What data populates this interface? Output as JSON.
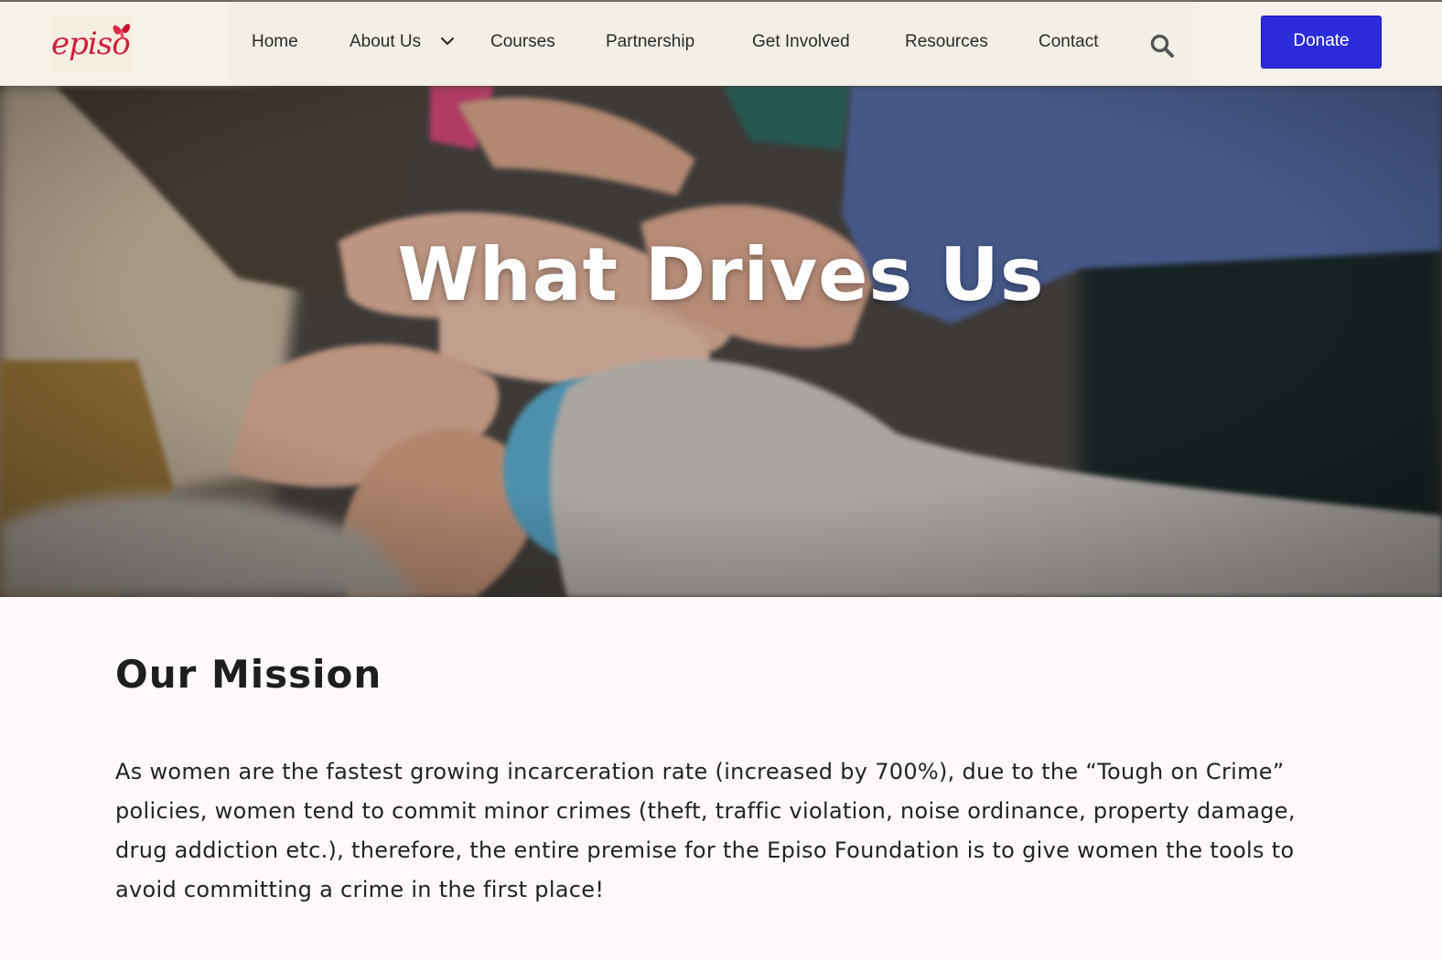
{
  "brand": {
    "logo_text": "episo",
    "accent_color": "#d11e3c"
  },
  "nav": {
    "items": [
      {
        "label": "Home"
      },
      {
        "label": "About Us",
        "has_dropdown": true
      },
      {
        "label": "Courses"
      },
      {
        "label": "Partnership"
      },
      {
        "label": "Get Involved"
      },
      {
        "label": "Resources"
      },
      {
        "label": "Contact"
      }
    ],
    "search_icon": "search-icon",
    "dropdown_icon": "chevron-down-icon"
  },
  "donate": {
    "label": "Donate",
    "color": "#2c2bd9"
  },
  "hero": {
    "title": "What Drives Us",
    "image": "hands-stacked-together"
  },
  "mission": {
    "heading": "Our Mission",
    "body": "As women are the fastest growing incarceration rate (increased by 700%), due to the “Tough on Crime” policies, women tend to commit minor crimes (theft, traffic violation, noise ordinance, property damage, drug addiction etc.), therefore, the entire premise for the Episo Foundation is to give women the tools to avoid committing a crime in the first place!"
  }
}
